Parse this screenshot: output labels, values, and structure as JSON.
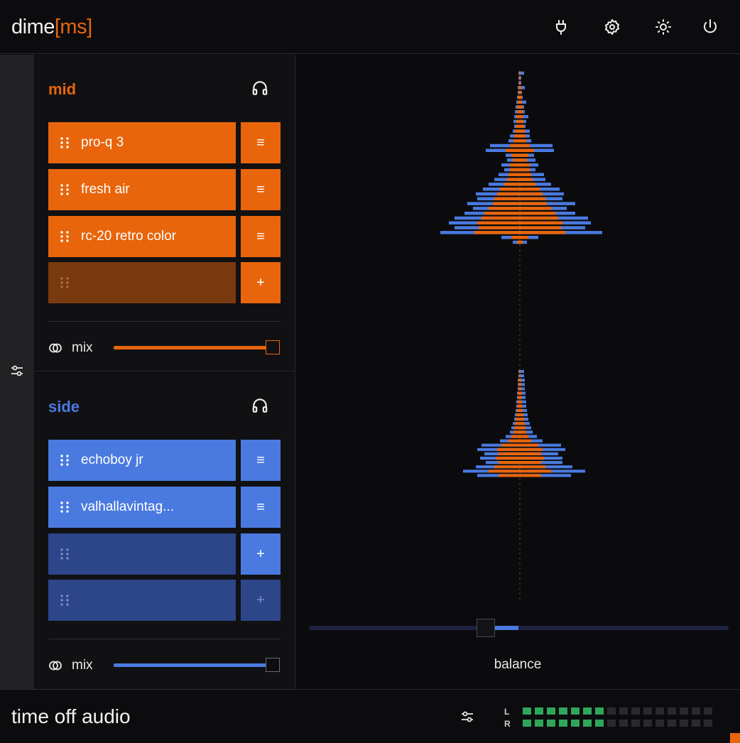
{
  "header": {
    "logo_main": "dime",
    "logo_accent": "[ms]",
    "icons": [
      "plug-icon",
      "gear-icon",
      "sun-icon",
      "power-icon"
    ]
  },
  "mid": {
    "title": "mid",
    "slots": [
      {
        "label": "pro-q 3",
        "state": "filled"
      },
      {
        "label": "fresh air",
        "state": "filled"
      },
      {
        "label": "rc-20 retro color",
        "state": "filled"
      },
      {
        "label": "",
        "state": "empty"
      }
    ],
    "mix_label": "mix",
    "mix_value": 1.0
  },
  "side": {
    "title": "side",
    "slots": [
      {
        "label": "echoboy jr",
        "state": "filled"
      },
      {
        "label": "valhallavintag...",
        "state": "filled"
      },
      {
        "label": "",
        "state": "empty"
      },
      {
        "label": "",
        "state": "empty"
      }
    ],
    "mix_label": "mix",
    "mix_value": 1.0
  },
  "visualizer": {
    "balance_label": "balance",
    "balance_value": 0.5
  },
  "footer": {
    "brand": "time off audio",
    "meter_left_label": "L",
    "meter_right_label": "R",
    "meter_segments": 16,
    "meter_left_lit": 7,
    "meter_right_lit": 7
  },
  "colors": {
    "mid_accent": "#e8650c",
    "side_accent": "#4a7ae0",
    "meter_on": "#2fa65a"
  }
}
